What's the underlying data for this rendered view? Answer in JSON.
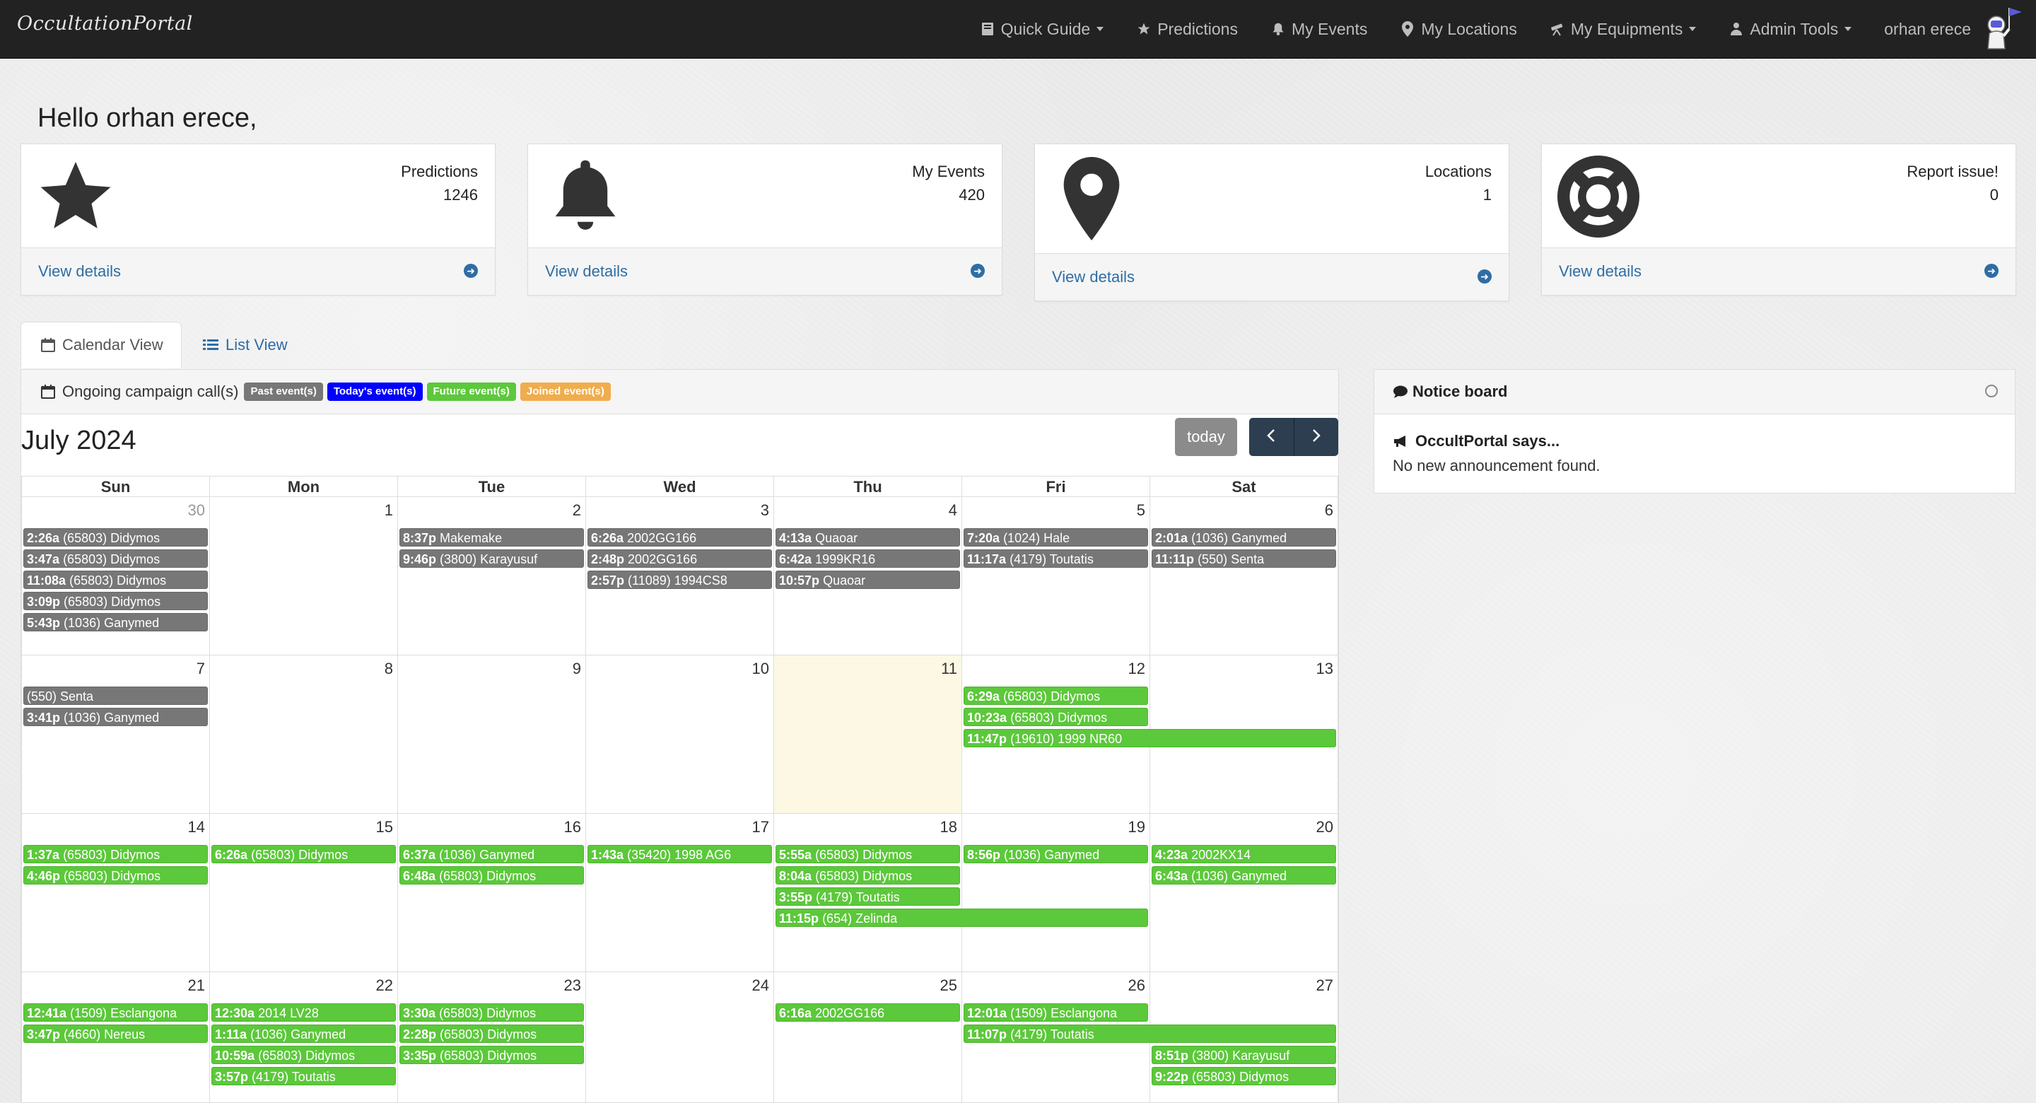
{
  "navbar": {
    "brand": "OccultationPortal",
    "items": [
      {
        "label": "Quick Guide",
        "icon": "book-icon",
        "dropdown": true
      },
      {
        "label": "Predictions",
        "icon": "star-icon",
        "dropdown": false
      },
      {
        "label": "My Events",
        "icon": "bell-icon",
        "dropdown": false
      },
      {
        "label": "My Locations",
        "icon": "map-pin-icon",
        "dropdown": false
      },
      {
        "label": "My Equipments",
        "icon": "telescope-icon",
        "dropdown": true
      },
      {
        "label": "Admin Tools",
        "icon": "user-icon",
        "dropdown": true
      }
    ],
    "user": "orhan erece"
  },
  "greeting": "Hello orhan erece,",
  "stats": [
    {
      "title": "Predictions",
      "value": "1246",
      "link": "View details",
      "icon": "star-icon"
    },
    {
      "title": "My Events",
      "value": "420",
      "link": "View details",
      "icon": "bell-icon"
    },
    {
      "title": "Locations",
      "value": "1",
      "link": "View details",
      "icon": "map-pin-icon"
    },
    {
      "title": "Report issue!",
      "value": "0",
      "link": "View details",
      "icon": "lifebuoy-icon"
    }
  ],
  "tabs": {
    "calendar": "Calendar View",
    "list": "List View"
  },
  "legend": {
    "title": "Ongoing campaign call(s)",
    "badges": [
      {
        "label": "Past event(s)",
        "color": "#777777"
      },
      {
        "label": "Today's event(s)",
        "color": "#0000ff"
      },
      {
        "label": "Future event(s)",
        "color": "#5cc83b"
      },
      {
        "label": "Joined event(s)",
        "color": "#f0ad4e"
      }
    ]
  },
  "calendar": {
    "month": "July 2024",
    "today_label": "today",
    "days": [
      "Sun",
      "Mon",
      "Tue",
      "Wed",
      "Thu",
      "Fri",
      "Sat"
    ],
    "weeks": [
      {
        "dates": [
          "30",
          "1",
          "2",
          "3",
          "4",
          "5",
          "6"
        ],
        "other": [
          0
        ],
        "today": -1,
        "events": [
          {
            "col": 0,
            "row": 0,
            "span": 1,
            "type": "past",
            "time": "2:26a",
            "text": "(65803) Didymos"
          },
          {
            "col": 0,
            "row": 1,
            "span": 1,
            "type": "past",
            "time": "3:47a",
            "text": "(65803) Didymos"
          },
          {
            "col": 0,
            "row": 2,
            "span": 1,
            "type": "past",
            "time": "11:08a",
            "text": "(65803) Didymos"
          },
          {
            "col": 0,
            "row": 3,
            "span": 1,
            "type": "past",
            "time": "3:09p",
            "text": "(65803) Didymos"
          },
          {
            "col": 0,
            "row": 4,
            "span": 1,
            "type": "past",
            "time": "5:43p",
            "text": "(1036) Ganymed"
          },
          {
            "col": 2,
            "row": 0,
            "span": 1,
            "type": "past",
            "time": "8:37p",
            "text": "Makemake"
          },
          {
            "col": 2,
            "row": 1,
            "span": 1,
            "type": "past",
            "time": "9:46p",
            "text": "(3800) Karayusuf"
          },
          {
            "col": 3,
            "row": 0,
            "span": 1,
            "type": "past",
            "time": "6:26a",
            "text": "2002GG166"
          },
          {
            "col": 3,
            "row": 1,
            "span": 1,
            "type": "past",
            "time": "2:48p",
            "text": "2002GG166"
          },
          {
            "col": 3,
            "row": 2,
            "span": 1,
            "type": "past",
            "time": "2:57p",
            "text": "(11089) 1994CS8"
          },
          {
            "col": 4,
            "row": 0,
            "span": 1,
            "type": "past",
            "time": "4:13a",
            "text": "Quaoar"
          },
          {
            "col": 4,
            "row": 1,
            "span": 1,
            "type": "past",
            "time": "6:42a",
            "text": "1999KR16"
          },
          {
            "col": 4,
            "row": 2,
            "span": 1,
            "type": "past",
            "time": "10:57p",
            "text": "Quaoar"
          },
          {
            "col": 5,
            "row": 0,
            "span": 1,
            "type": "past",
            "time": "7:20a",
            "text": "(1024) Hale"
          },
          {
            "col": 5,
            "row": 1,
            "span": 1,
            "type": "past",
            "time": "11:17a",
            "text": "(4179) Toutatis"
          },
          {
            "col": 6,
            "row": 0,
            "span": 1,
            "type": "past",
            "time": "2:01a",
            "text": "(1036) Ganymed"
          },
          {
            "col": 6,
            "row": 1,
            "span": 1,
            "type": "past",
            "time": "11:11p",
            "text": "(550) Senta"
          }
        ]
      },
      {
        "dates": [
          "7",
          "8",
          "9",
          "10",
          "11",
          "12",
          "13"
        ],
        "other": [],
        "today": 4,
        "events": [
          {
            "col": 0,
            "row": 0,
            "span": 1,
            "type": "past",
            "time": "",
            "text": "(550) Senta"
          },
          {
            "col": 0,
            "row": 1,
            "span": 1,
            "type": "past",
            "time": "3:41p",
            "text": "(1036) Ganymed"
          },
          {
            "col": 5,
            "row": 0,
            "span": 1,
            "type": "future",
            "time": "6:29a",
            "text": "(65803) Didymos"
          },
          {
            "col": 5,
            "row": 1,
            "span": 1,
            "type": "future",
            "time": "10:23a",
            "text": "(65803) Didymos"
          },
          {
            "col": 5,
            "row": 2,
            "span": 2,
            "type": "future",
            "time": "11:47p",
            "text": "(19610) 1999 NR60"
          }
        ]
      },
      {
        "dates": [
          "14",
          "15",
          "16",
          "17",
          "18",
          "19",
          "20"
        ],
        "other": [],
        "today": -1,
        "events": [
          {
            "col": 0,
            "row": 0,
            "span": 1,
            "type": "future",
            "time": "1:37a",
            "text": "(65803) Didymos"
          },
          {
            "col": 0,
            "row": 1,
            "span": 1,
            "type": "future",
            "time": "4:46p",
            "text": "(65803) Didymos"
          },
          {
            "col": 1,
            "row": 0,
            "span": 1,
            "type": "future",
            "time": "6:26a",
            "text": "(65803) Didymos"
          },
          {
            "col": 2,
            "row": 0,
            "span": 1,
            "type": "future",
            "time": "6:37a",
            "text": "(1036) Ganymed"
          },
          {
            "col": 2,
            "row": 1,
            "span": 1,
            "type": "future",
            "time": "6:48a",
            "text": "(65803) Didymos"
          },
          {
            "col": 3,
            "row": 0,
            "span": 1,
            "type": "future",
            "time": "1:43a",
            "text": "(35420) 1998 AG6"
          },
          {
            "col": 4,
            "row": 0,
            "span": 1,
            "type": "future",
            "time": "5:55a",
            "text": "(65803) Didymos"
          },
          {
            "col": 4,
            "row": 1,
            "span": 1,
            "type": "future",
            "time": "8:04a",
            "text": "(65803) Didymos"
          },
          {
            "col": 4,
            "row": 2,
            "span": 1,
            "type": "future",
            "time": "3:55p",
            "text": "(4179) Toutatis"
          },
          {
            "col": 4,
            "row": 3,
            "span": 2,
            "type": "future",
            "time": "11:15p",
            "text": "(654) Zelinda"
          },
          {
            "col": 5,
            "row": 0,
            "span": 1,
            "type": "future",
            "time": "8:56p",
            "text": "(1036) Ganymed"
          },
          {
            "col": 6,
            "row": 0,
            "span": 1,
            "type": "future",
            "time": "4:23a",
            "text": "2002KX14"
          },
          {
            "col": 6,
            "row": 1,
            "span": 1,
            "type": "future",
            "time": "6:43a",
            "text": "(1036) Ganymed"
          }
        ]
      },
      {
        "dates": [
          "21",
          "22",
          "23",
          "24",
          "25",
          "26",
          "27"
        ],
        "other": [],
        "today": -1,
        "events": [
          {
            "col": 0,
            "row": 0,
            "span": 1,
            "type": "future",
            "time": "12:41a",
            "text": "(1509) Esclangona"
          },
          {
            "col": 0,
            "row": 1,
            "span": 1,
            "type": "future",
            "time": "3:47p",
            "text": "(4660) Nereus"
          },
          {
            "col": 1,
            "row": 0,
            "span": 1,
            "type": "future",
            "time": "12:30a",
            "text": "2014 LV28"
          },
          {
            "col": 1,
            "row": 1,
            "span": 1,
            "type": "future",
            "time": "1:11a",
            "text": "(1036) Ganymed"
          },
          {
            "col": 1,
            "row": 2,
            "span": 1,
            "type": "future",
            "time": "10:59a",
            "text": "(65803) Didymos"
          },
          {
            "col": 1,
            "row": 3,
            "span": 1,
            "type": "future",
            "time": "3:57p",
            "text": "(4179) Toutatis"
          },
          {
            "col": 2,
            "row": 0,
            "span": 1,
            "type": "future",
            "time": "3:30a",
            "text": "(65803) Didymos"
          },
          {
            "col": 2,
            "row": 1,
            "span": 1,
            "type": "future",
            "time": "2:28p",
            "text": "(65803) Didymos"
          },
          {
            "col": 2,
            "row": 2,
            "span": 1,
            "type": "future",
            "time": "3:35p",
            "text": "(65803) Didymos"
          },
          {
            "col": 4,
            "row": 0,
            "span": 1,
            "type": "future",
            "time": "6:16a",
            "text": "2002GG166"
          },
          {
            "col": 5,
            "row": 0,
            "span": 1,
            "type": "future",
            "time": "12:01a",
            "text": "(1509) Esclangona"
          },
          {
            "col": 5,
            "row": 1,
            "span": 2,
            "type": "future",
            "time": "11:07p",
            "text": "(4179) Toutatis"
          },
          {
            "col": 6,
            "row": 2,
            "span": 1,
            "type": "future",
            "time": "8:51p",
            "text": "(3800) Karayusuf"
          },
          {
            "col": 6,
            "row": 3,
            "span": 1,
            "type": "future",
            "time": "9:22p",
            "text": "(65803) Didymos"
          }
        ]
      }
    ]
  },
  "notice": {
    "title": "Notice board",
    "says": "OccultPortal says...",
    "message": "No new announcement found."
  }
}
